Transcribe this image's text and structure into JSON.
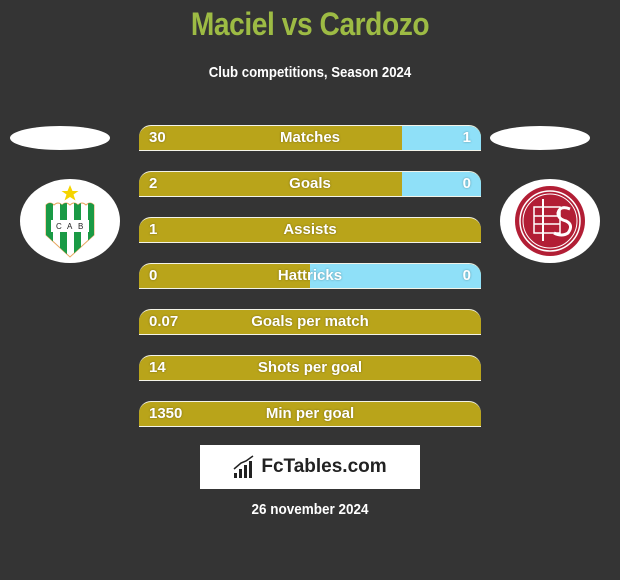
{
  "header": {
    "title": "Maciel vs Cardozo",
    "subtitle": "Club competitions, Season 2024"
  },
  "players": {
    "left": {
      "name": "Maciel",
      "club_logo": "banfield-crest-icon"
    },
    "right": {
      "name": "Cardozo",
      "club_logo": "lanus-crest-icon"
    }
  },
  "colors": {
    "background": "#343434",
    "title": "#9dbb44",
    "left_bar": "#b9a41a",
    "right_bar": "#8fe0f8"
  },
  "stats": [
    {
      "label": "Matches",
      "left": "30",
      "right": "1",
      "right_share": 0.23
    },
    {
      "label": "Goals",
      "left": "2",
      "right": "0",
      "right_share": 0.23
    },
    {
      "label": "Assists",
      "left": "1",
      "right": "",
      "right_share": 0
    },
    {
      "label": "Hattricks",
      "left": "0",
      "right": "0",
      "right_share": 0.5
    },
    {
      "label": "Goals per match",
      "left": "0.07",
      "right": "",
      "right_share": 0
    },
    {
      "label": "Shots per goal",
      "left": "14",
      "right": "",
      "right_share": 0
    },
    {
      "label": "Min per goal",
      "left": "1350",
      "right": "",
      "right_share": 0
    }
  ],
  "brand": {
    "name": "FcTables.com",
    "icon": "bar-chart-icon"
  },
  "footer": {
    "date": "26 november 2024"
  }
}
